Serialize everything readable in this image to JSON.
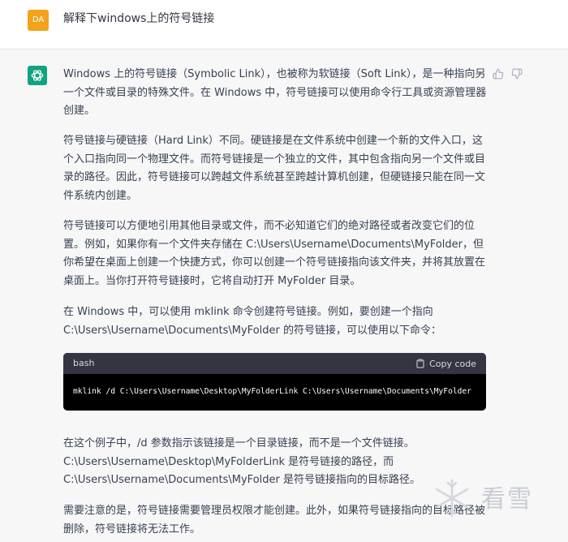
{
  "user_message": {
    "avatar_text": "DA",
    "text": "解释下windows上的符号链接"
  },
  "assistant_message": {
    "paragraphs": [
      "Windows 上的符号链接（Symbolic Link），也被称为软链接（Soft Link），是一种指向另一个文件或目录的特殊文件。在 Windows 中，符号链接可以使用命令行工具或资源管理器创建。",
      "符号链接与硬链接（Hard Link）不同。硬链接是在文件系统中创建一个新的文件入口，这个入口指向同一个物理文件。而符号链接是一个独立的文件，其中包含指向另一个文件或目录的路径。因此，符号链接可以跨越文件系统甚至跨越计算机创建，但硬链接只能在同一文件系统内创建。",
      "符号链接可以方便地引用其他目录或文件，而不必知道它们的绝对路径或者改变它们的位置。例如，如果你有一个文件夹存储在 C:\\Users\\Username\\Documents\\MyFolder，但你希望在桌面上创建一个快捷方式，你可以创建一个符号链接指向该文件夹，并将其放置在桌面上。当你打开符号链接时，它将自动打开 MyFolder 目录。",
      "在 Windows 中，可以使用 mklink 命令创建符号链接。例如，要创建一个指向 C:\\Users\\Username\\Documents\\MyFolder 的符号链接，可以使用以下命令：",
      "在这个例子中，/d 参数指示该链接是一个目录链接，而不是一个文件链接。C:\\Users\\Username\\Desktop\\MyFolderLink 是符号链接的路径，而 C:\\Users\\Username\\Documents\\MyFolder 是符号链接指向的目标路径。",
      "需要注意的是，符号链接需要管理员权限才能创建。此外，如果符号链接指向的目标路径被删除，符号链接将无法工作。"
    ],
    "code_block": {
      "language": "bash",
      "copy_label": "Copy code",
      "code": "mklink /d C:\\Users\\Username\\Desktop\\MyFolderLink C:\\Users\\Username\\Documents\\MyFolder"
    }
  },
  "watermark": {
    "text": "看雪"
  },
  "colors": {
    "user_avatar": "#f2a21b",
    "bot_avatar": "#10a37f",
    "code_header": "#343541",
    "code_body": "#000000",
    "page_bg": "#f7f7f8"
  },
  "icons": [
    "openai-logo-icon",
    "thumbs-up-icon",
    "thumbs-down-icon",
    "clipboard-icon",
    "kanxue-logo-icon"
  ]
}
